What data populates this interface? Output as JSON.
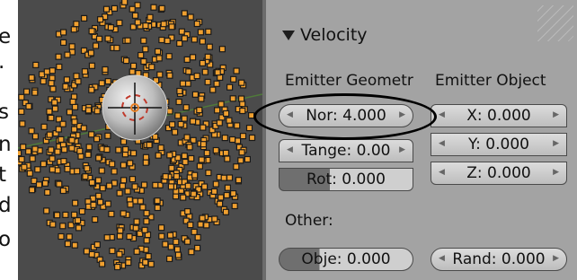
{
  "left_strip": [
    "e",
    ".",
    "s",
    "n",
    "t",
    "d",
    "o"
  ],
  "panel": {
    "title": "Velocity",
    "emitter_geometry": {
      "label": "Emitter Geometr",
      "normal": "Nor: 4.000",
      "tangent": "Tange: 0.00",
      "rotation": "Rot: 0.000"
    },
    "emitter_object": {
      "label": "Emitter Object",
      "x": "X: 0.000",
      "y": "Y: 0.000",
      "z": "Z: 0.000"
    },
    "other": {
      "label": "Other:",
      "object": "Obje: 0.000",
      "random": "Rand: 0.000"
    }
  },
  "colors": {
    "particle": "#f0a030",
    "viewport_bg": "#4b4b4b",
    "panel_bg": "#a3a3a3",
    "grid_line": "#4f7a3a"
  },
  "icons": [
    "triangle-down-icon",
    "left-arrow-icon",
    "right-arrow-icon"
  ]
}
